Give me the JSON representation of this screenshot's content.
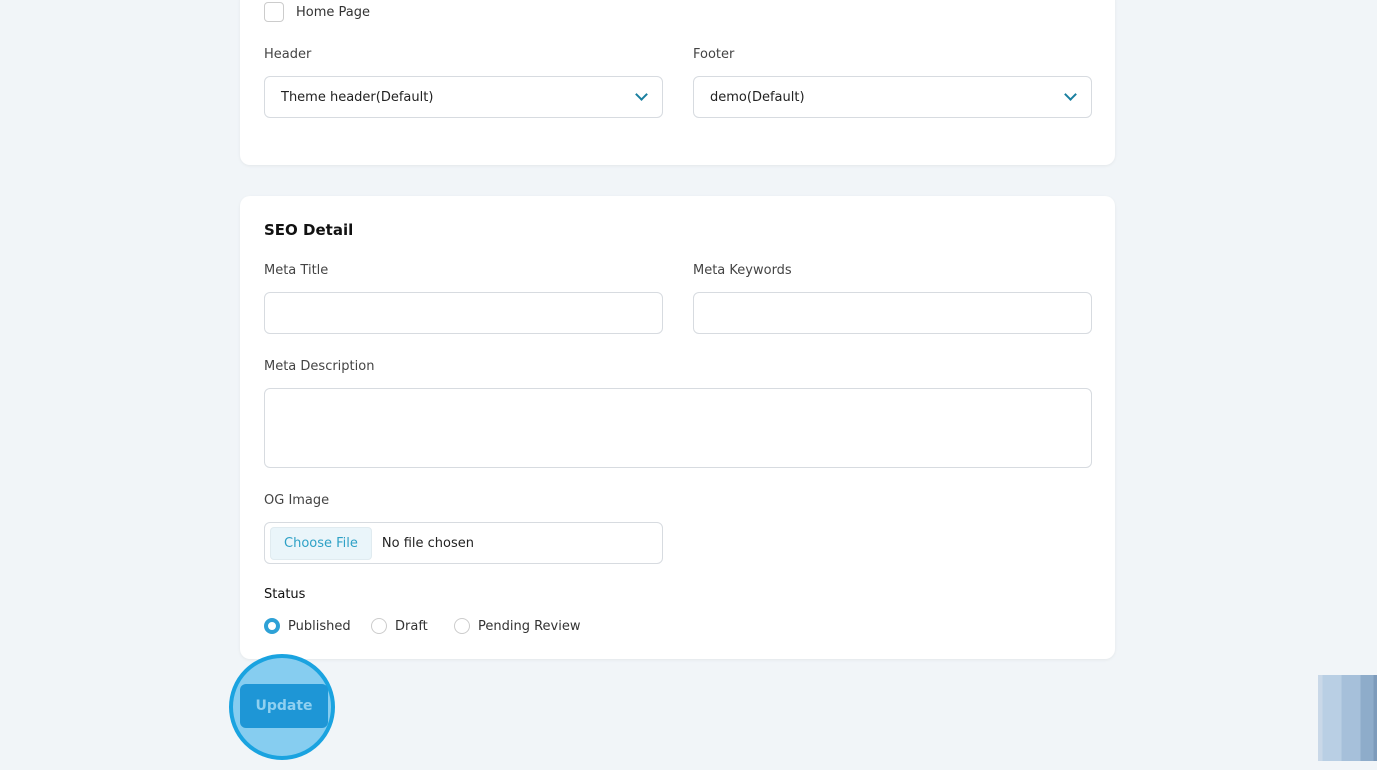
{
  "layout": {
    "home_page_label": "Home Page",
    "header_label": "Header",
    "header_value": "Theme header(Default)",
    "footer_label": "Footer",
    "footer_value": "demo(Default)"
  },
  "seo": {
    "title": "SEO Detail",
    "meta_title_label": "Meta Title",
    "meta_title_value": "",
    "meta_keywords_label": "Meta Keywords",
    "meta_keywords_value": "",
    "meta_description_label": "Meta Description",
    "meta_description_value": "",
    "og_image_label": "OG Image",
    "choose_file_label": "Choose File",
    "no_file_label": "No file chosen"
  },
  "status": {
    "label": "Status",
    "options": [
      "Published",
      "Draft",
      "Pending Review"
    ],
    "selected": "Published"
  },
  "update_label": "Update",
  "colors": {
    "accent": "#2ea1d6",
    "button": "#1e96d6",
    "background": "#f1f5f8"
  }
}
